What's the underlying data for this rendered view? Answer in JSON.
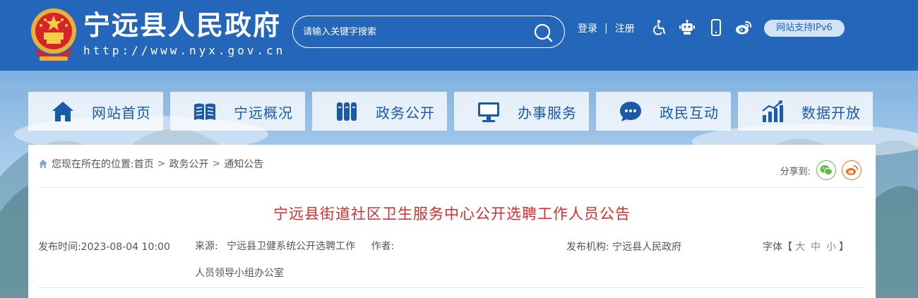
{
  "header": {
    "site_title": "宁远县人民政府",
    "site_url": "http://www.nyx.gov.cn",
    "search_placeholder": "请输入关键字搜索",
    "login": "登录",
    "separator": "|",
    "register": "注册",
    "ipv6_badge": "网站支持IPv6",
    "icons": [
      "accessibility-icon",
      "robot-icon",
      "mobile-icon",
      "weibo-icon"
    ],
    "brand_color": "#2466b9"
  },
  "nav": {
    "items": [
      {
        "label": "网站首页",
        "icon": "home-icon"
      },
      {
        "label": "宁远概况",
        "icon": "book-icon"
      },
      {
        "label": "政务公开",
        "icon": "files-icon"
      },
      {
        "label": "办事服务",
        "icon": "monitor-icon"
      },
      {
        "label": "政民互动",
        "icon": "chat-icon"
      },
      {
        "label": "数据开放",
        "icon": "chart-icon"
      }
    ]
  },
  "breadcrumb": {
    "prefix": "您现在所在的位置:",
    "items": [
      "首页",
      "政务公开",
      "通知公告"
    ],
    "arrow": ">"
  },
  "share": {
    "label": "分享到:",
    "targets": [
      "wechat-icon",
      "weibo-icon"
    ]
  },
  "article": {
    "title": "宁远县街道社区卫生服务中心公开选聘工作人员公告",
    "title_color": "#d42f2f",
    "publish_label": "发布时间:",
    "publish_time": "2023-08-04 10:00",
    "source_label": "来源:",
    "source_line1": "宁远县卫健系统公开选聘工作",
    "source_line2": "人员领导小组办公室",
    "author_label": "作者:",
    "author": "",
    "org_label": "发布机构:",
    "org": "宁远县人民政府",
    "font_label": "字体【",
    "font_large": "大",
    "font_medium": "中",
    "font_small": "小",
    "font_end": "】"
  }
}
